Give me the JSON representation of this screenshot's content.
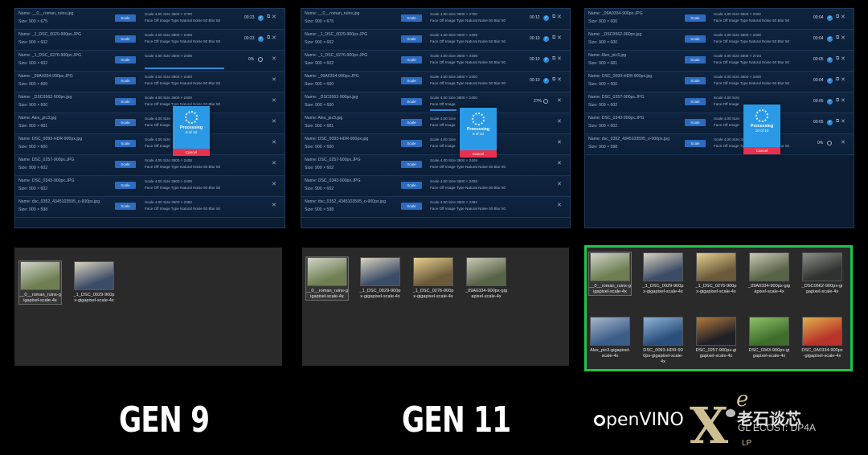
{
  "panels": [
    {
      "label": "GEN 9",
      "dialog": {
        "title": "Processing",
        "count": "5 of 10",
        "cancel": "Cancel"
      },
      "rows": [
        {
          "name": "Name: __0__roman_ruins.jpg",
          "size": "Size: 900 × 675",
          "button": "Scale",
          "meta1": "Scale 4.00  Size 3600 × 2700",
          "meta2": "Face Off  Image Type Natural  Noise 50  Blur 50",
          "time": "00:23",
          "done": true
        },
        {
          "name": "Name: _1_DSC_0029-900px.JPG",
          "size": "Size: 900 × 602",
          "button": "Scale",
          "meta1": "Scale 4.00  Size 3600 × 2408",
          "meta2": "Face Off  Image Type Natural  Noise 50  Blur 50",
          "time": "00:23",
          "done": true
        },
        {
          "name": "Name: _1_DSC_0276-900px.JPG",
          "size": "Size: 900 × 602",
          "button": "Scale",
          "meta1": "Scale 4.00  Size 3600 × 2408",
          "meta2": "",
          "percent": "0%",
          "progress": 0.9
        },
        {
          "name": "Name: _09A0334-900px.JPG",
          "size": "Size: 900 × 600",
          "button": "Scale",
          "meta1": "Scale 4.00  Size 3600 × 2400",
          "meta2": "Face Off  Image Type Natural  Noise 50  Blur 50"
        },
        {
          "name": "Name: _DSC0562-900px.jpg",
          "size": "Size: 900 × 600",
          "button": "Scale",
          "meta1": "Scale 4.00  Size 3600 × 2400",
          "meta2": "Face Off  Image Type Natural  Noise 50  Blur 50"
        },
        {
          "name": "Name: Alex_pic3.jpg",
          "size": "Size: 900 × 681",
          "button": "Scale",
          "meta1": "Scale 4.00  Size",
          "meta2": "Face Off  Image"
        },
        {
          "name": "Name: DSC_0093-HDR-900px.jpg",
          "size": "Size: 900 × 600",
          "button": "Scale",
          "meta1": "Scale 4.00  Size",
          "meta2": "Face Off  Image"
        },
        {
          "name": "Name: DSC_0257-900px.JPG",
          "size": "Size: 900 × 602",
          "button": "Scale",
          "meta1": "Scale 4.00  Size 3600 × 2408",
          "meta2": "Face Off  Image Type Natural  Noise 50  Blur 50"
        },
        {
          "name": "Name: DSC_0343-900px.JPG",
          "size": "Size: 900 × 602",
          "button": "Scale",
          "meta1": "Scale 4.00  Size 3600 × 2408",
          "meta2": "Face Off  Image Type Natural  Noise 50  Blur 50"
        },
        {
          "name": "Name: dsc_0352_4345103595_o-900px.jpg",
          "size": "Size: 900 × 598",
          "button": "Scale",
          "meta1": "Scale 4.00  Size 3600 × 2392",
          "meta2": "Face Off  Image Type Natural  Noise 50  Blur 50"
        }
      ],
      "thumbs": [
        {
          "label": "__0__roman_ruins-gigapixel-scale-4x",
          "color1": "#6f7f52",
          "color2": "#cfd4c9",
          "selected": true
        },
        {
          "label": "_1_DSC_0029-900px-gigapixel-scale-4x",
          "color1": "#3c4c66",
          "color2": "#d9d2bf"
        }
      ]
    },
    {
      "label": "GEN 11",
      "dialog": {
        "title": "Processing",
        "count": "5 of 10",
        "cancel": "Cancel"
      },
      "rows": [
        {
          "name": "Name: __0__roman_ruins.jpg",
          "size": "Size: 900 × 675",
          "button": "Scale",
          "meta1": "Scale 4.00  Size 3600 × 2700",
          "meta2": "Face Off  Image Type Natural  Noise 50  Blur 50",
          "time": "00:12",
          "done": true
        },
        {
          "name": "Name: _1_DSC_0029-900px.JPG",
          "size": "Size: 900 × 602",
          "button": "Scale",
          "meta1": "Scale 4.00  Size 3600 × 2408",
          "meta2": "Face Off  Image Type Natural  Noise 50  Blur 50",
          "time": "00:10",
          "done": true
        },
        {
          "name": "Name: _1_DSC_0276-900px.JPG",
          "size": "Size: 900 × 602",
          "button": "Scale",
          "meta1": "Scale 4.00  Size 3600 × 2408",
          "meta2": "Face Off  Image Type Natural  Noise 50  Blur 50",
          "time": "00:10",
          "done": true
        },
        {
          "name": "Name: _09A0334-900px.JPG",
          "size": "Size: 900 × 600",
          "button": "Scale",
          "meta1": "Scale 4.00  Size 3600 × 2400",
          "meta2": "Face Off  Image Type Natural  Noise 50  Blur 50",
          "time": "00:10",
          "done": true
        },
        {
          "name": "Name: _DSC0562-900px.jpg",
          "size": "Size: 900 × 600",
          "button": "Scale",
          "meta1": "Scale 4.00  Size 3600 × 2400",
          "meta2": "Face Off  Image",
          "percent": "27%",
          "progress": 0.3
        },
        {
          "name": "Name: Alex_pic3.jpg",
          "size": "Size: 900 × 681",
          "button": "Scale",
          "meta1": "Scale 4.00  Size",
          "meta2": "Face Off  Image"
        },
        {
          "name": "Name: DSC_0093-HDR-900px.jpg",
          "size": "Size: 900 × 600",
          "button": "Scale",
          "meta1": "Scale 4.00  Size",
          "meta2": "Face Off  Image"
        },
        {
          "name": "Name: DSC_0257-900px.JPG",
          "size": "Size: 900 × 602",
          "button": "Scale",
          "meta1": "Scale 4.00  Size 3600 × 2408",
          "meta2": "Face Off  Image Type Natural  Noise 50  Blur 50"
        },
        {
          "name": "Name: DSC_0343-900px.JPG",
          "size": "Size: 900 × 602",
          "button": "Scale",
          "meta1": "Scale 4.00  Size 3600 × 2408",
          "meta2": "Face Off  Image Type Natural  Noise 50  Blur 50"
        },
        {
          "name": "Name: dsc_0352_4345103595_o-900px.jpg",
          "size": "Size: 900 × 598",
          "button": "Scale",
          "meta1": "Scale 4.00  Size 3600 × 2392",
          "meta2": "Face Off  Image Type Natural  Noise 50  Blur 50"
        }
      ],
      "thumbs": [
        {
          "label": "__0__roman_ruins-gigapixel-scale-4x",
          "color1": "#6f7f52",
          "color2": "#cfd4c9",
          "selected": true
        },
        {
          "label": "_1_DSC_0029-900px-gigapixel-scale-4x",
          "color1": "#3c4c66",
          "color2": "#d9d2bf"
        },
        {
          "label": "_1_DSC_0276-900px-gigapixel-scale-4x",
          "color1": "#6b5a3a",
          "color2": "#e6cf8e"
        },
        {
          "label": "_09A0334-900px-gigapixel-scale-4x",
          "color1": "#586448",
          "color2": "#c9c9b4"
        }
      ]
    },
    {
      "label": "",
      "dialog": {
        "title": "Processing",
        "count": "10 of 10",
        "cancel": "Cancel"
      },
      "rows": [
        {
          "name": "Name: _09A0334-900px.JPG",
          "size": "Size: 900 × 600",
          "button": "Scale",
          "meta1": "Scale 4.00  Size 3600 × 2400",
          "meta2": "Face Off  Image Type Natural  Noise 50  Blur 50",
          "time": "00:04",
          "done": true
        },
        {
          "name": "Name: _DSC0562-900px.jpg",
          "size": "Size: 900 × 600",
          "button": "Scale",
          "meta1": "Scale 4.00  Size 3600 × 2400",
          "meta2": "Face Off  Image Type Natural  Noise 50  Blur 50",
          "time": "00:04",
          "done": true
        },
        {
          "name": "Name: Alex_pic3.jpg",
          "size": "Size: 900 × 681",
          "button": "Scale",
          "meta1": "Scale 4.00  Size 3600 × 2724",
          "meta2": "Face Off  Image Type Natural  Noise 50  Blur 50",
          "time": "00:05",
          "done": true
        },
        {
          "name": "Name: DSC_0093-HDR-900px.jpg",
          "size": "Size: 900 × 600",
          "button": "Scale",
          "meta1": "Scale 4.00  Size 3600 × 2400",
          "meta2": "Face Off  Image Type Natural  Noise 50  Blur 50",
          "time": "00:04",
          "done": true
        },
        {
          "name": "Name: DSC_0257-900px.JPG",
          "size": "Size: 900 × 602",
          "button": "Scale",
          "meta1": "Scale 4.00  Size",
          "meta2": "Face Off  Image",
          "time": "00:05",
          "done": true
        },
        {
          "name": "Name: DSC_0343-900px.JPG",
          "size": "Size: 900 × 602",
          "button": "Scale",
          "meta1": "Scale 4.00  Size",
          "meta2": "Face Off  Image",
          "time": "00:05",
          "done": true
        },
        {
          "name": "Name: dsc_0352_4345103595_o-900px.jpg",
          "size": "Size: 900 × 598",
          "button": "Scale",
          "meta1": "Scale 4.00  Size 3600 × 2392",
          "meta2": "Face Off  Image Type Natural  Noise 50  Blur 50",
          "percent": "0%",
          "progress": 0.0
        }
      ],
      "thumbs": [
        {
          "label": "__0__roman_ruins-gigapixel-scale-4x",
          "color1": "#6f7f52",
          "color2": "#cfd4c9",
          "selected": true
        },
        {
          "label": "_1_DSC_0029-900px-gigapixel-scale-4x",
          "color1": "#3c4c66",
          "color2": "#d9d2bf"
        },
        {
          "label": "_1_DSC_0276-900px-gigapixel-scale-4x",
          "color1": "#6b5a3a",
          "color2": "#e6cf8e"
        },
        {
          "label": "_09A0334-900px-gigapixel-scale-4x",
          "color1": "#586448",
          "color2": "#c9c9b4"
        },
        {
          "label": "_DSC0562-900px-gigapixel-scale-4x",
          "color1": "#2f3330",
          "color2": "#8a8f86"
        },
        {
          "label": "Alex_pic3-gigapixel-scale-4x",
          "color1": "#3c5d8a",
          "color2": "#a7b7c9"
        },
        {
          "label": "DSC_0093-HDR-900px-gigapixel-scale-4x",
          "color1": "#2a4f7c",
          "color2": "#8fb3d7"
        },
        {
          "label": "DSC_0257-900px-gigapixel-scale-4x",
          "color1": "#1f2028",
          "color2": "#b47a3c"
        },
        {
          "label": "DSC_0343-900px-gigapixel-scale-4x",
          "color1": "#3f6e2c",
          "color2": "#8fc06a"
        },
        {
          "label": "DSC_0A0334-900px-gigapixel-scale-4x",
          "color1": "#b8342a",
          "color2": "#e0b14a"
        }
      ]
    }
  ],
  "brand": {
    "openvino": "penVINO",
    "xe_x": "X",
    "xe_e": "e",
    "lp": "LP",
    "watermark": "老石谈芯",
    "watermark_sub": "GL ECOST: DP4A"
  },
  "colors": {
    "highlight_border": "#22c44a",
    "panel_bg": "#0c1d33",
    "scale_button": "#2c6bbf",
    "cancel": "#e8314e",
    "dialog": "#2b9ae6"
  }
}
